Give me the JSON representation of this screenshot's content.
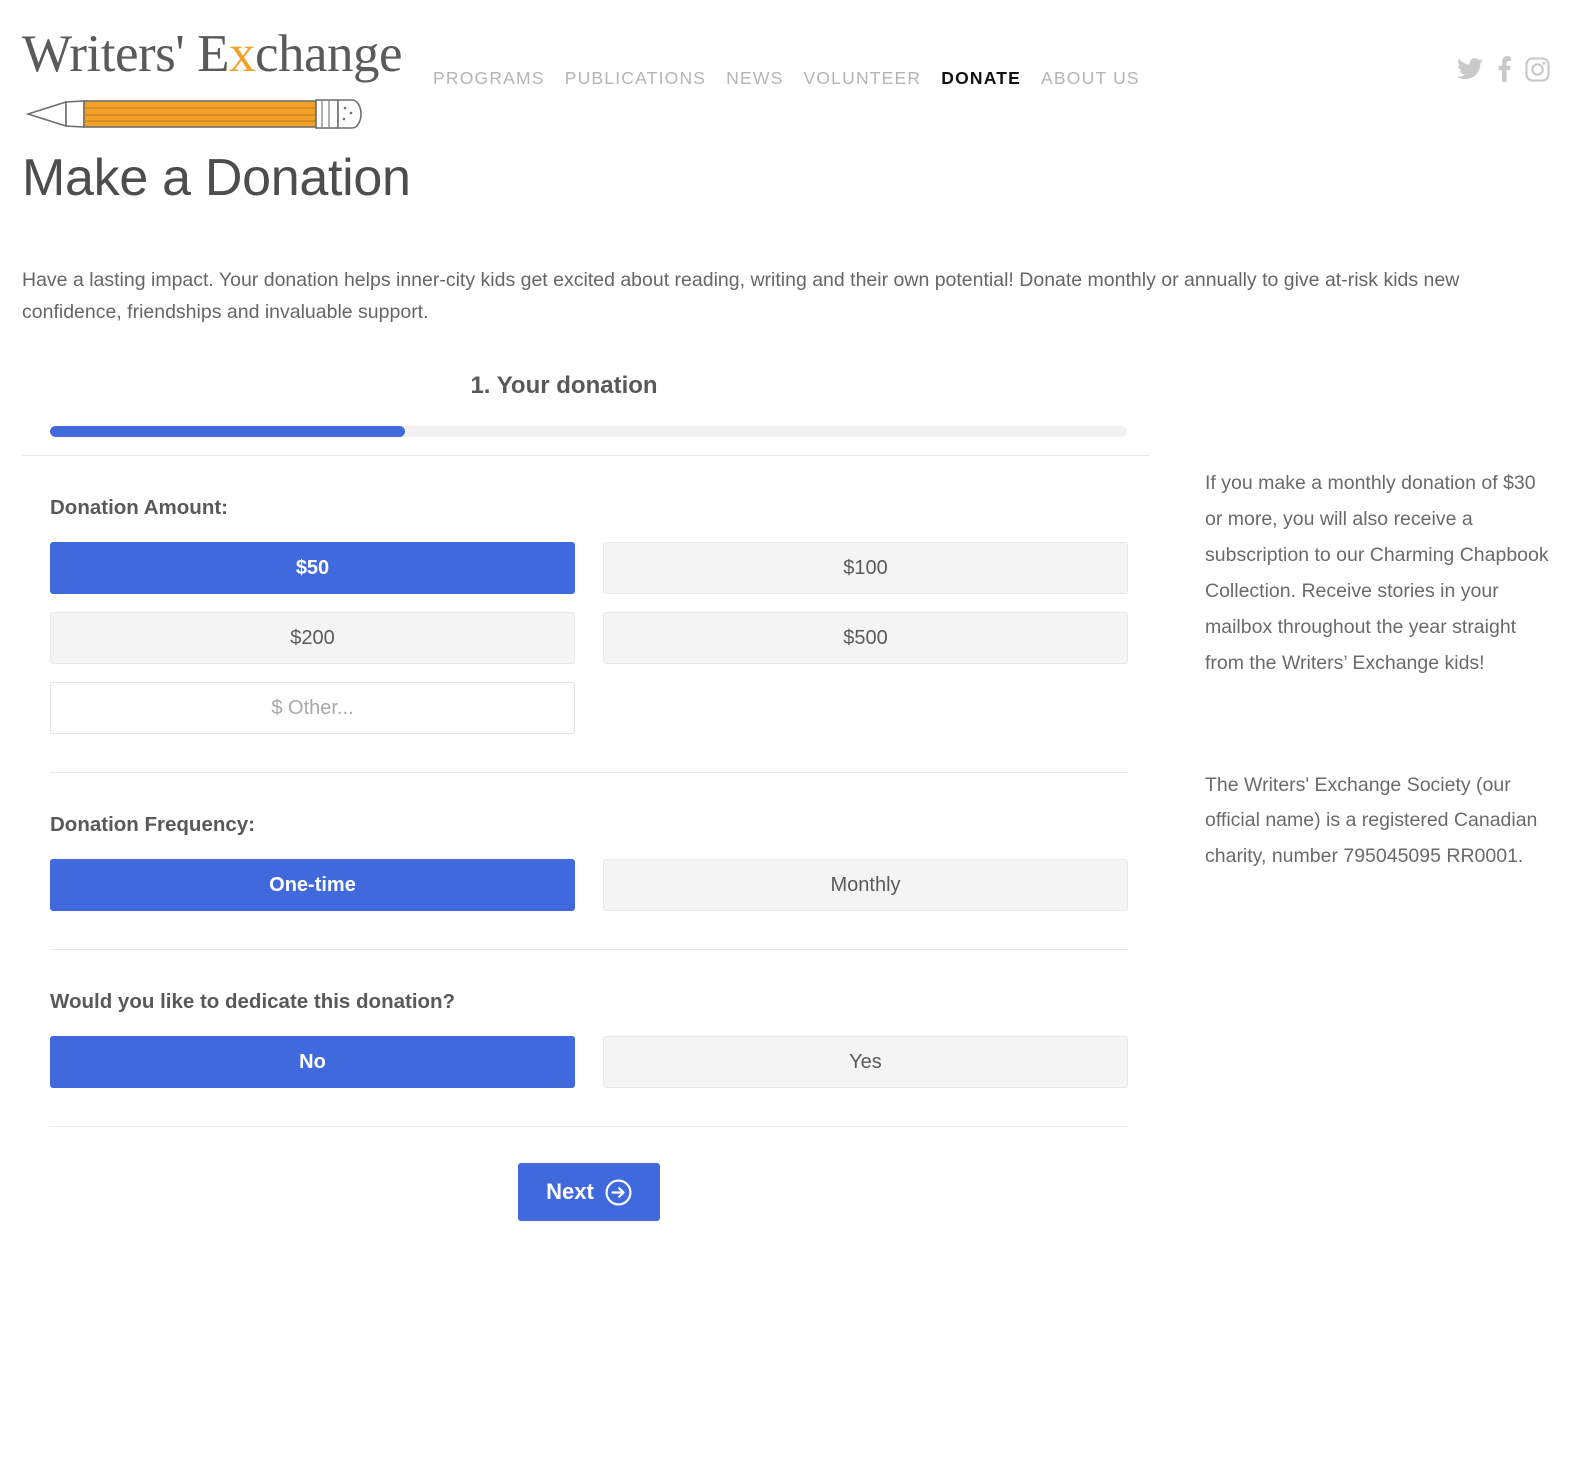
{
  "header": {
    "logo": {
      "text_before": "Writers' E",
      "text_accent": "x",
      "text_after": "change",
      "icon": "pencil-icon"
    },
    "nav": [
      {
        "label": "PROGRAMS",
        "active": false
      },
      {
        "label": "PUBLICATIONS",
        "active": false
      },
      {
        "label": "NEWS",
        "active": false
      },
      {
        "label": "VOLUNTEER",
        "active": false
      },
      {
        "label": "DONATE",
        "active": true
      },
      {
        "label": "ABOUT US",
        "active": false
      }
    ],
    "social": [
      {
        "name": "twitter-icon"
      },
      {
        "name": "facebook-icon"
      },
      {
        "name": "instagram-icon"
      }
    ]
  },
  "page": {
    "title": "Make a Donation",
    "intro": "Have a lasting impact. Your donation helps inner-city kids get excited about reading, writing and their own potential! Donate monthly or annually to give at-risk kids new confidence, friendships and invaluable support."
  },
  "form": {
    "step_title": "1. Your donation",
    "progress_percent": 33,
    "amount": {
      "label": "Donation Amount:",
      "options": [
        {
          "label": "$50",
          "selected": true
        },
        {
          "label": "$100",
          "selected": false
        },
        {
          "label": "$200",
          "selected": false
        },
        {
          "label": "$500",
          "selected": false
        }
      ],
      "other_placeholder": "$ Other...",
      "other_value": ""
    },
    "frequency": {
      "label": "Donation Frequency:",
      "options": [
        {
          "label": "One-time",
          "selected": true
        },
        {
          "label": "Monthly",
          "selected": false
        }
      ]
    },
    "dedicate": {
      "label": "Would you like to dedicate this donation?",
      "options": [
        {
          "label": "No",
          "selected": true
        },
        {
          "label": "Yes",
          "selected": false
        }
      ]
    },
    "next_label": "Next",
    "next_icon": "arrow-right-circle-icon"
  },
  "aside": {
    "paragraph_1": "If you make a monthly donation of $30 or more, you will also receive a subscription to our Charming Chapbook Collection. Receive stories in your mailbox throughout the year straight from the Writers’ Exchange kids!",
    "paragraph_2": "The Writers' Exchange Society (our official name) is a registered Canadian charity, number 795045095 RR0001."
  },
  "colors": {
    "accent_blue": "#4169DE",
    "logo_orange": "#F2A229",
    "muted_gray": "#b4b4b4",
    "button_gray": "#f4f4f4"
  }
}
